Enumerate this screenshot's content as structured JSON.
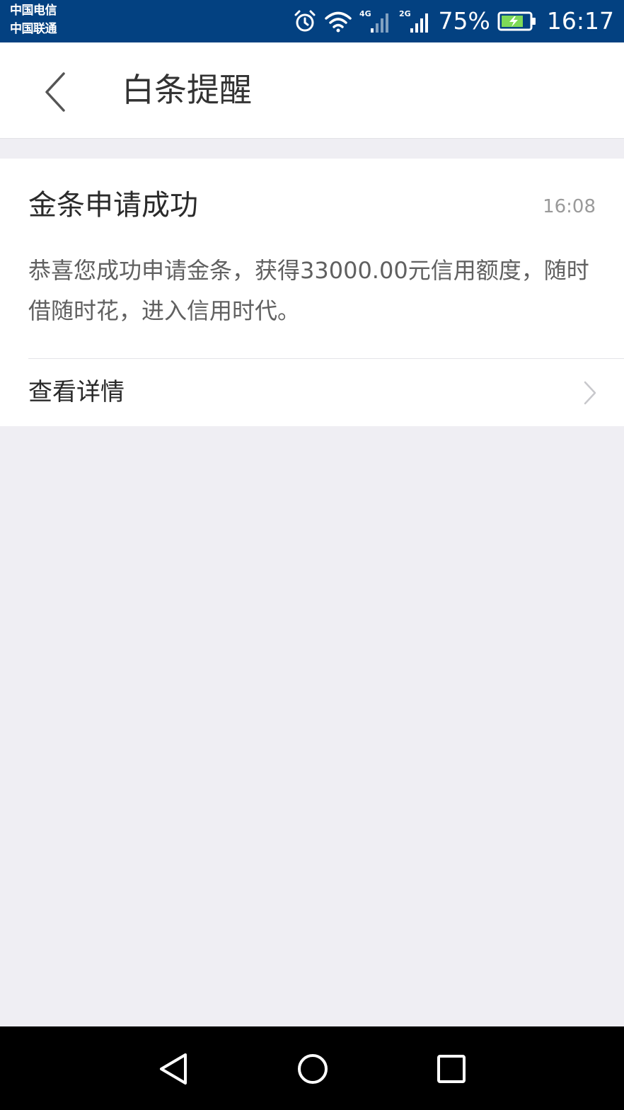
{
  "status_bar": {
    "carrier_1": "中国电信",
    "carrier_2": "中国联通",
    "network_1": "4G",
    "network_2": "2G",
    "battery_percent": "75%",
    "time": "16:17",
    "icons": [
      "alarm-icon",
      "wifi-icon",
      "signal-4g-icon",
      "signal-2g-icon",
      "battery-charging-icon"
    ],
    "bg_color": "#034181"
  },
  "header": {
    "title": "白条提醒"
  },
  "message": {
    "title": "金条申请成功",
    "time": "16:08",
    "body": "恭喜您成功申请金条，获得33000.00元信用额度，随时借随时花，进入信用时代。",
    "details_label": "查看详情"
  },
  "nav_bar": {
    "icons": [
      "nav-back-icon",
      "nav-home-icon",
      "nav-recent-apps-icon"
    ]
  },
  "colors": {
    "page_bg": "#efeef3",
    "card_bg": "#ffffff",
    "text_primary": "#2a2a2a",
    "text_secondary": "#606060",
    "text_muted": "#9a9a9a"
  }
}
